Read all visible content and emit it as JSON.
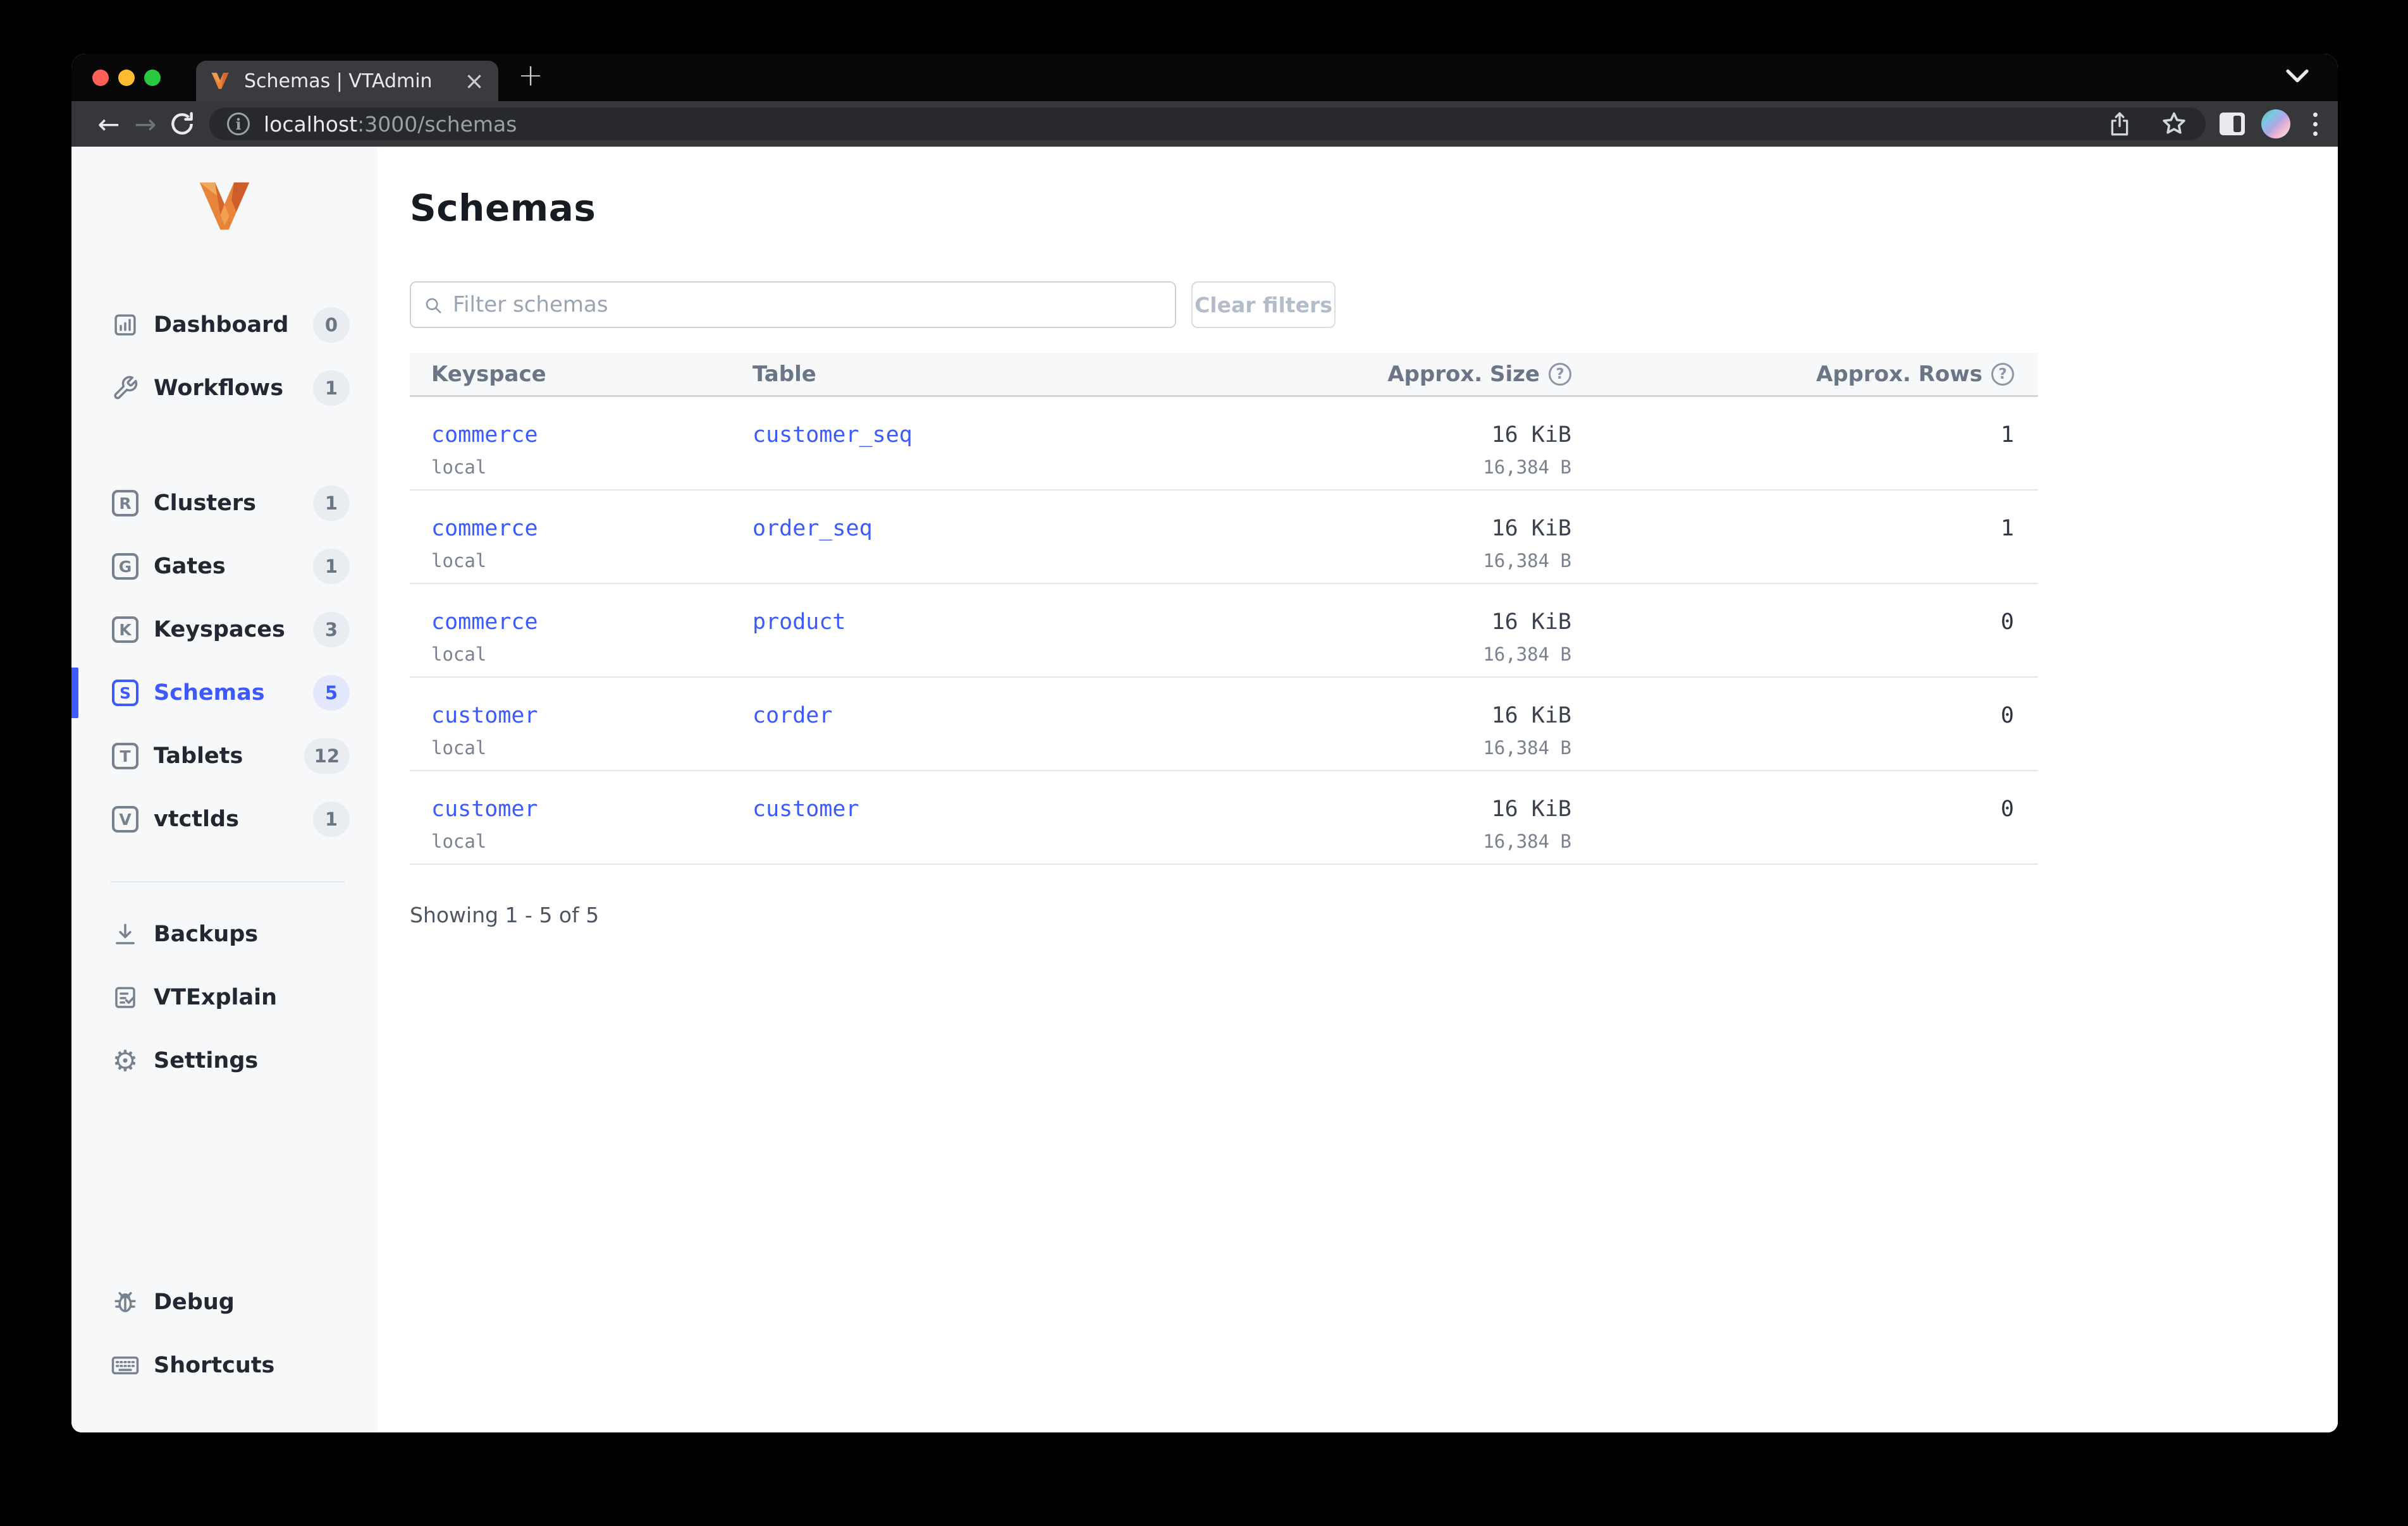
{
  "browser": {
    "tab_title": "Schemas | VTAdmin",
    "close_glyph": "×",
    "newtab_glyph": "+",
    "back_glyph": "←",
    "forward_glyph": "→",
    "url_host": "localhost",
    "url_path": ":3000/schemas",
    "info_glyph": "i"
  },
  "colors": {
    "accent": "#3d5afe",
    "traffic_red": "#ff5f57",
    "traffic_yellow": "#febc2e",
    "traffic_green": "#28c840"
  },
  "sidebar": {
    "items": [
      {
        "label": "Dashboard",
        "badge": "0"
      },
      {
        "label": "Workflows",
        "badge": "1"
      },
      {
        "label": "Clusters",
        "badge": "1",
        "letter": "R"
      },
      {
        "label": "Gates",
        "badge": "1",
        "letter": "G"
      },
      {
        "label": "Keyspaces",
        "badge": "3",
        "letter": "K"
      },
      {
        "label": "Schemas",
        "badge": "5",
        "letter": "S"
      },
      {
        "label": "Tablets",
        "badge": "12",
        "letter": "T"
      },
      {
        "label": "vtctlds",
        "badge": "1",
        "letter": "V"
      },
      {
        "label": "Backups"
      },
      {
        "label": "VTExplain"
      },
      {
        "label": "Settings",
        "gear_glyph": "⚙"
      },
      {
        "label": "Debug"
      },
      {
        "label": "Shortcuts"
      }
    ]
  },
  "main": {
    "title": "Schemas",
    "filter": {
      "placeholder": "Filter schemas"
    },
    "clear_button": "Clear filters",
    "help_glyph": "?",
    "table": {
      "headers": {
        "keyspace": "Keyspace",
        "table": "Table",
        "size": "Approx. Size",
        "rows": "Approx. Rows"
      },
      "rows": [
        {
          "keyspace": "commerce",
          "cluster": "local",
          "table": "customer_seq",
          "size": "16 KiB",
          "size_bytes": "16,384 B",
          "rowcount": "1"
        },
        {
          "keyspace": "commerce",
          "cluster": "local",
          "table": "order_seq",
          "size": "16 KiB",
          "size_bytes": "16,384 B",
          "rowcount": "1"
        },
        {
          "keyspace": "commerce",
          "cluster": "local",
          "table": "product",
          "size": "16 KiB",
          "size_bytes": "16,384 B",
          "rowcount": "0"
        },
        {
          "keyspace": "customer",
          "cluster": "local",
          "table": "corder",
          "size": "16 KiB",
          "size_bytes": "16,384 B",
          "rowcount": "0"
        },
        {
          "keyspace": "customer",
          "cluster": "local",
          "table": "customer",
          "size": "16 KiB",
          "size_bytes": "16,384 B",
          "rowcount": "0"
        }
      ]
    },
    "footer": "Showing 1 - 5 of 5"
  }
}
